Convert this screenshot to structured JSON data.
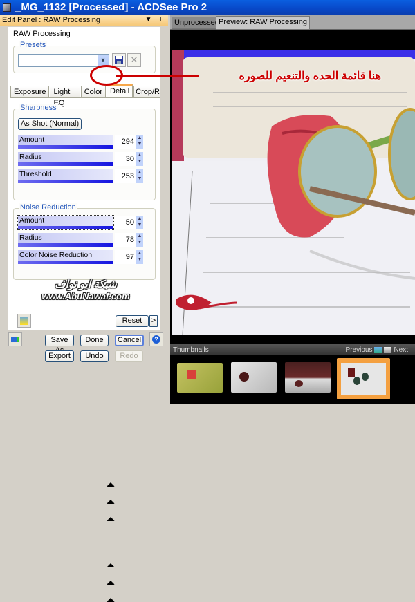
{
  "window": {
    "title": "_MG_1132 [Processed] - ACDSee Pro 2"
  },
  "edit_panel": {
    "header": "Edit Panel : RAW Processing",
    "section_title": "RAW Processing",
    "presets": {
      "legend": "Presets",
      "selected": ""
    },
    "tabs": [
      {
        "label": "Exposure",
        "active": false
      },
      {
        "label": "Light EQ",
        "active": false
      },
      {
        "label": "Color",
        "active": false
      },
      {
        "label": "Detail",
        "active": true
      },
      {
        "label": "Crop/Rotate",
        "active": false
      }
    ],
    "sharpness": {
      "legend": "Sharpness",
      "preset_button": "As Shot (Normal)",
      "sliders": [
        {
          "label": "Amount",
          "value": "294",
          "fraction": 1.0
        },
        {
          "label": "Radius",
          "value": "30",
          "fraction": 1.0
        },
        {
          "label": "Threshold",
          "value": "253",
          "fraction": 1.0
        }
      ]
    },
    "noise_reduction": {
      "legend": "Noise Reduction",
      "sliders": [
        {
          "label": "Amount",
          "value": "50",
          "fraction": 1.0
        },
        {
          "label": "Radius",
          "value": "78",
          "fraction": 1.0
        },
        {
          "label": "Color Noise Reduction",
          "value": "97",
          "fraction": 1.0
        }
      ]
    },
    "watermark": {
      "arabic": "شبكة ابو نواف",
      "url": "www.AbuNawaf.com"
    },
    "reset_label": "Reset",
    "more_label": ">",
    "buttons": {
      "save_as": "Save As",
      "done": "Done",
      "cancel": "Cancel",
      "export": "Export",
      "undo": "Undo",
      "redo": "Redo"
    }
  },
  "preview": {
    "tabs": [
      {
        "label": "Unprocessed",
        "active": false
      },
      {
        "label": "Preview: RAW Processing",
        "active": true
      }
    ],
    "annotation": "هنا قائمة الحده والتنعيم للصوره"
  },
  "thumbnails": {
    "title": "Thumbnails",
    "previous": "Previous",
    "next": "Next",
    "count": 4,
    "selected_index": 3
  },
  "colors": {
    "accent": "#f7a84a",
    "annotation": "#cc0000",
    "slider_fill": "#1414e0"
  }
}
